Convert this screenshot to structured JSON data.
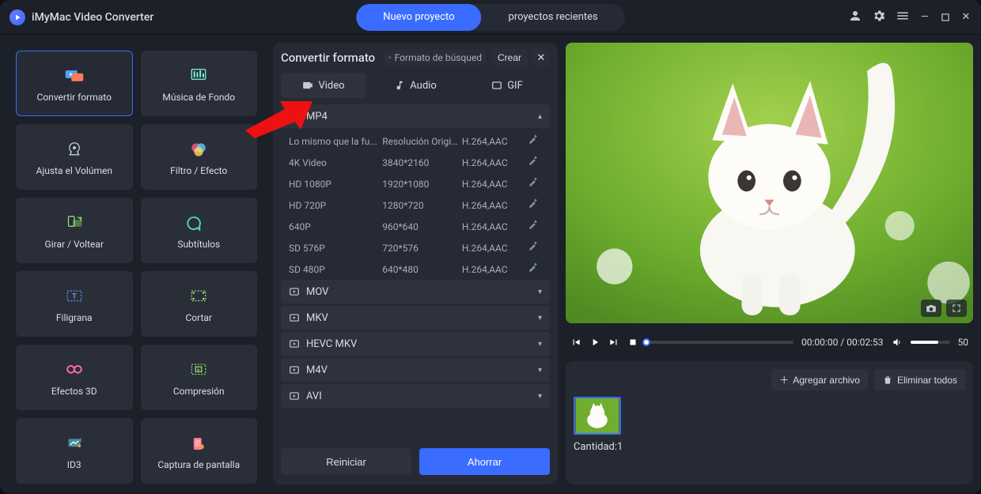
{
  "app_title": "iMyMac Video Converter",
  "topnav": {
    "new_project": "Nuevo proyecto",
    "recent_projects": "proyectos recientes"
  },
  "sidebar": {
    "tools": [
      {
        "label": "Convertir formato",
        "icon": "convert"
      },
      {
        "label": "Música de Fondo",
        "icon": "music"
      },
      {
        "label": "Ajusta el Volúmen",
        "icon": "volume"
      },
      {
        "label": "Filtro / Efecto",
        "icon": "filter"
      },
      {
        "label": "Girar / Voltear",
        "icon": "rotate"
      },
      {
        "label": "Subtítulos",
        "icon": "subtitle"
      },
      {
        "label": "Filigrana",
        "icon": "watermark"
      },
      {
        "label": "Cortar",
        "icon": "cut"
      },
      {
        "label": "Efectos 3D",
        "icon": "effects3d"
      },
      {
        "label": "Compresión",
        "icon": "compress"
      },
      {
        "label": "ID3",
        "icon": "id3"
      },
      {
        "label": "Captura de pantalla",
        "icon": "screenshot"
      }
    ]
  },
  "center": {
    "title": "Convertir formato",
    "search_placeholder": "Formato de búsqued",
    "create_label": "Crear",
    "tabs": {
      "video": "Video",
      "audio": "Audio",
      "gif": "GIF"
    },
    "groups": [
      {
        "name": "MP4",
        "expanded": true,
        "rows": [
          {
            "name": "Lo mismo que la fu...",
            "res": "Resolución Original",
            "codec": "H.264,AAC"
          },
          {
            "name": "4K Video",
            "res": "3840*2160",
            "codec": "H.264,AAC"
          },
          {
            "name": "HD 1080P",
            "res": "1920*1080",
            "codec": "H.264,AAC"
          },
          {
            "name": "HD 720P",
            "res": "1280*720",
            "codec": "H.264,AAC"
          },
          {
            "name": "640P",
            "res": "960*640",
            "codec": "H.264,AAC"
          },
          {
            "name": "SD 576P",
            "res": "720*576",
            "codec": "H.264,AAC"
          },
          {
            "name": "SD 480P",
            "res": "640*480",
            "codec": "H.264,AAC"
          }
        ]
      },
      {
        "name": "MOV",
        "expanded": false
      },
      {
        "name": "MKV",
        "expanded": false
      },
      {
        "name": "HEVC MKV",
        "expanded": false
      },
      {
        "name": "M4V",
        "expanded": false
      },
      {
        "name": "AVI",
        "expanded": false
      }
    ],
    "reset_label": "Reiniciar",
    "save_label": "Ahorrar"
  },
  "player": {
    "current_time": "00:00:00",
    "total_time": "00:02:53",
    "volume": "50"
  },
  "assets": {
    "add_file_label": "Agregar archivo",
    "remove_all_label": "Eliminar todos",
    "count_label": "Cantidad:1"
  }
}
